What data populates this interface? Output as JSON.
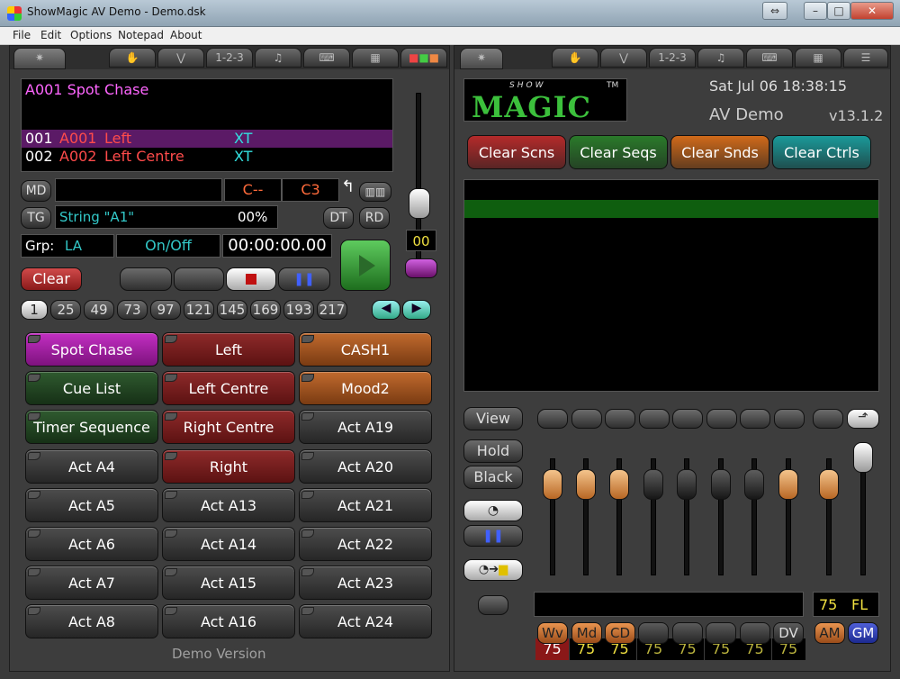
{
  "window": {
    "title": "ShowMagic AV Demo - Demo.dsk"
  },
  "menu": [
    "File",
    "Edit",
    "Options",
    "Notepad",
    "About"
  ],
  "tabs": {
    "left": [
      "",
      "",
      "",
      "1-2-3",
      "♫",
      "",
      "",
      ""
    ],
    "right": [
      "",
      "",
      "",
      "1-2-3",
      "♫",
      "",
      "",
      ""
    ]
  },
  "cue": {
    "current": "A001  Spot Chase",
    "rows": [
      {
        "num": "001",
        "id": "A001",
        "name": "Left",
        "tag": "XT"
      },
      {
        "num": "002",
        "id": "A002",
        "name": "Left Centre",
        "tag": "XT"
      }
    ],
    "md_label": "MD",
    "md_c": "C--",
    "md_c3": "C3",
    "tg_label": "TG",
    "tg_value": "String \"A1\"",
    "tg_pct": "00%",
    "dt_label": "DT",
    "rd_label": "RD",
    "grp_label": "Grp:",
    "grp_value": "LA",
    "onoff": "On/Off",
    "time": "00:00:00.00",
    "clear": "Clear",
    "fader_value": "00"
  },
  "pages": [
    "1",
    "25",
    "49",
    "73",
    "97",
    "121",
    "145",
    "169",
    "193",
    "217"
  ],
  "grid": [
    {
      "label": "Spot Chase",
      "color": "purple"
    },
    {
      "label": "Left",
      "color": "red"
    },
    {
      "label": "CASH1",
      "color": "orange"
    },
    {
      "label": "Cue List",
      "color": "green"
    },
    {
      "label": "Left Centre",
      "color": "red"
    },
    {
      "label": "Mood2",
      "color": "orange"
    },
    {
      "label": "Timer Sequence",
      "color": "green"
    },
    {
      "label": "Right Centre",
      "color": "red"
    },
    {
      "label": "Act A19",
      "color": "dark"
    },
    {
      "label": "Act A4",
      "color": "dark"
    },
    {
      "label": "Right",
      "color": "red"
    },
    {
      "label": "Act A20",
      "color": "dark"
    },
    {
      "label": "Act A5",
      "color": "dark"
    },
    {
      "label": "Act A13",
      "color": "dark"
    },
    {
      "label": "Act A21",
      "color": "dark"
    },
    {
      "label": "Act A6",
      "color": "dark"
    },
    {
      "label": "Act A14",
      "color": "dark"
    },
    {
      "label": "Act A22",
      "color": "dark"
    },
    {
      "label": "Act A7",
      "color": "dark"
    },
    {
      "label": "Act A15",
      "color": "dark"
    },
    {
      "label": "Act A23",
      "color": "dark"
    },
    {
      "label": "Act A8",
      "color": "dark"
    },
    {
      "label": "Act A16",
      "color": "dark"
    },
    {
      "label": "Act A24",
      "color": "dark"
    }
  ],
  "demo_version": "Demo Version",
  "right": {
    "logo_top": "SHOW",
    "logo_main": "MAGIC",
    "logo_tm": "TM",
    "datetime": "Sat Jul 06 18:38:15",
    "show": "AV Demo",
    "version": "v13.1.2",
    "clear_buttons": [
      {
        "label": "Clear Scns",
        "color": "#b42a2a"
      },
      {
        "label": "Clear Seqs",
        "color": "#2a7a2a"
      },
      {
        "label": "Clear Snds",
        "color": "#d06a1a"
      },
      {
        "label": "Clear Ctrls",
        "color": "#1a9a9a"
      }
    ],
    "view": "View",
    "hold": "Hold",
    "black": "Black",
    "levels": [
      "75",
      "75",
      "75",
      "75",
      "75",
      "75",
      "75",
      "75"
    ],
    "master_level": "75",
    "master_label": "FL",
    "bottom_buttons": [
      "Wv",
      "Md",
      "CD",
      "",
      "",
      "",
      "",
      "DV",
      "AM",
      "GM"
    ]
  },
  "colors": {
    "accent_magenta": "#ff66ff",
    "accent_cyan": "#33e0e0",
    "accent_red": "#ff3b3b",
    "list_green": "#0f5e0f"
  }
}
